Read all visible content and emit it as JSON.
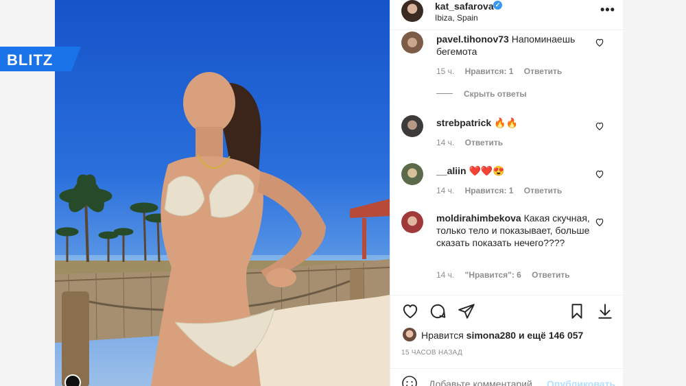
{
  "brand": {
    "logo_text": "BLITZ",
    "color": "#1a73e8"
  },
  "post": {
    "username": "kat_safarova",
    "verified": true,
    "location": "Ibiza, Spain"
  },
  "comments": [
    {
      "user": "pavel.tihonov73",
      "text": "Напоминаешь бегемота",
      "time": "15 ч.",
      "likes": "Нравится: 1",
      "reply": "Ответить"
    },
    {
      "hide_replies": "Скрыть ответы"
    },
    {
      "user": "strebpatrick",
      "text": "🔥🔥",
      "time": "14 ч.",
      "reply": "Ответить"
    },
    {
      "user": "__aliin",
      "text": "❤️❤️😍",
      "time": "14 ч.",
      "likes": "Нравится: 1",
      "reply": "Ответить"
    },
    {
      "user": "moldirahimbekova",
      "text": "Какая скучная, только тело и показывает, больше сказать показать нечего????",
      "time": "14 ч.",
      "likes": "\"Нравится\": 6",
      "reply": "Ответить"
    }
  ],
  "likes": {
    "prefix": "Нравится",
    "user": "simona280",
    "suffix": "и ещё 146 057"
  },
  "time_ago": "15 ЧАСОВ НАЗАД",
  "add_comment": {
    "placeholder": "Добавьте комментарий...",
    "publish": "Опубликовать"
  },
  "colors": {
    "link": "#3897f0",
    "text": "#262626",
    "muted": "#8e8e8e",
    "heart_red": "#ed4956"
  }
}
